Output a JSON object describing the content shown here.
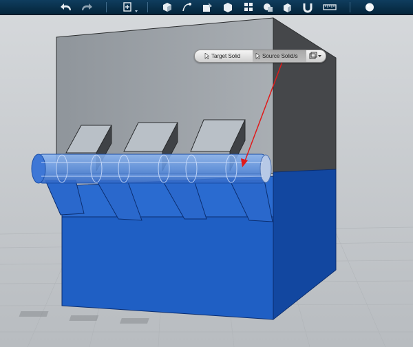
{
  "toolbar": {
    "items": [
      {
        "icon": "undo-icon"
      },
      {
        "icon": "redo-icon"
      },
      {
        "icon": "add-icon"
      },
      {
        "icon": "primitives-icon"
      },
      {
        "icon": "sketch-icon"
      },
      {
        "icon": "construct-icon"
      },
      {
        "icon": "modify-icon"
      },
      {
        "icon": "pattern-icon"
      },
      {
        "icon": "group-icon"
      },
      {
        "icon": "combine-icon"
      },
      {
        "icon": "snap-icon"
      },
      {
        "icon": "measure-icon"
      },
      {
        "icon": "material-icon"
      }
    ]
  },
  "selector": {
    "target_label": "Target Solid",
    "source_label": "Source Solid/s",
    "active": "source",
    "mode_icon": "selection-mode-icon"
  },
  "scene": {
    "objects": [
      "back-wall",
      "blue-base",
      "hinge-pin",
      "hinge-knuckles",
      "hinge-tabs"
    ],
    "annotation": "red-arrow",
    "colors": {
      "base": "#1f5fc4",
      "base_dark": "#1247a0",
      "pin_transparent": "#6f9fe6",
      "wall_front": "#a1a6ab",
      "wall_side": "#45474a",
      "arrow": "#e01a1a",
      "toolbar": "#062b45"
    }
  }
}
